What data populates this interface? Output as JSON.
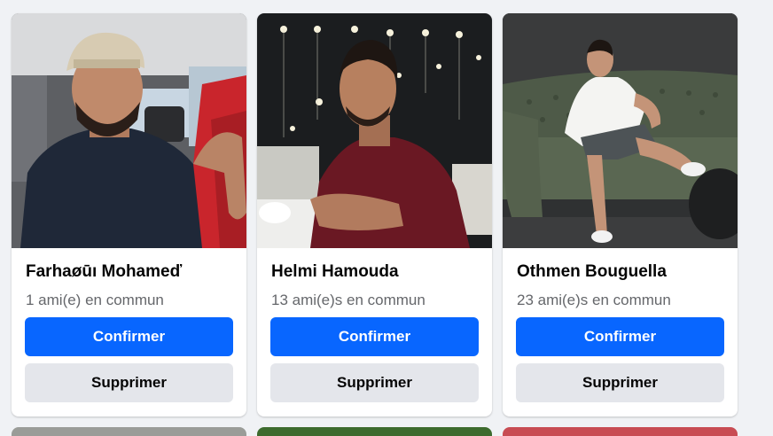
{
  "requests": [
    {
      "name": "Farhaøūı Mohameď",
      "mutual": "1 ami(e) en commun",
      "confirm_label": "Confirmer",
      "delete_label": "Supprimer",
      "photo": "man-in-car-with-cap"
    },
    {
      "name": "Helmi Hamouda",
      "mutual": "13 ami(e)s en commun",
      "confirm_label": "Confirmer",
      "delete_label": "Supprimer",
      "photo": "man-at-night-terrace"
    },
    {
      "name": "Othmen Bouguella",
      "mutual": "23 ami(e)s en commun",
      "confirm_label": "Confirmer",
      "delete_label": "Supprimer",
      "photo": "man-on-green-sofa"
    }
  ],
  "colors": {
    "primary": "#0866ff",
    "secondary_button": "#e4e6eb",
    "background": "#f0f2f5",
    "text": "#050505",
    "muted_text": "#65676b"
  }
}
